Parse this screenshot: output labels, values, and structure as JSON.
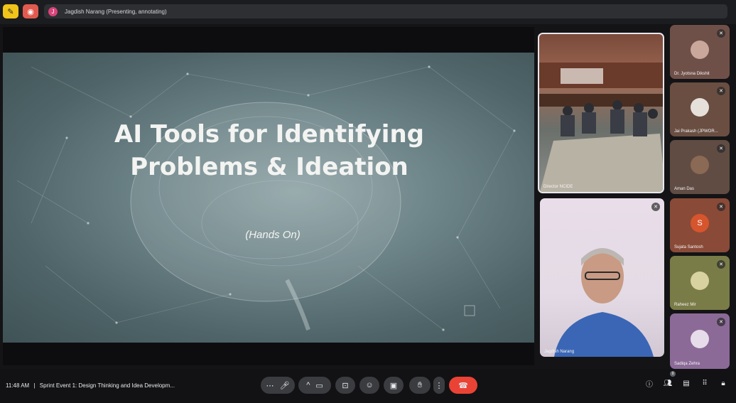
{
  "header": {
    "annotate_icon": "pencil-icon",
    "record_icon": "record-icon",
    "presenter_initial": "J",
    "presenter_status": "Jagdish Narang (Presenting, annotating)"
  },
  "slide": {
    "title_line1": "AI Tools for Identifying",
    "title_line2": "Problems & Ideation",
    "subtitle": "(Hands On)"
  },
  "participants": {
    "main": [
      {
        "name": "Director NCIDE"
      },
      {
        "name": "Jagdish Narang"
      }
    ],
    "sidebar": [
      {
        "name": "Dr. Jyotsna Dikshit"
      },
      {
        "name": "Jai Prakash (JPWOR..."
      },
      {
        "name": "Aman Das"
      },
      {
        "name": "Sujata Santosh",
        "initial": "S"
      },
      {
        "name": "Raheez Mir"
      },
      {
        "name": "Sadiqa Zehra"
      }
    ]
  },
  "footer": {
    "time": "11:48 AM",
    "separator": "|",
    "meeting_title": "Sprint Event 1: Design Thinking and Idea Developm...",
    "people_count": "9"
  },
  "colors": {
    "end_call": "#ea4335",
    "annotate": "#f0c419",
    "record": "#e25a4f",
    "sujata_avatar": "#d6552d"
  }
}
